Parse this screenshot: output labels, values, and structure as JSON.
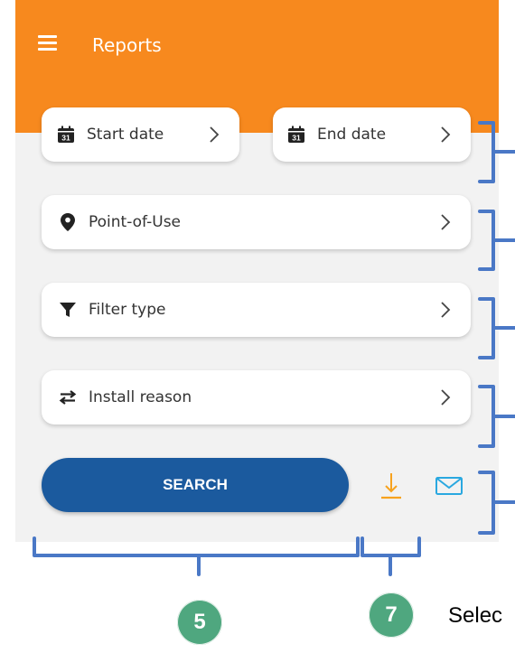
{
  "header": {
    "title": "Reports"
  },
  "filters": {
    "start_date": "Start date",
    "end_date": "End date",
    "calendar_day": "31",
    "point_of_use": "Point-of-Use",
    "filter_type": "Filter type",
    "install_reason": "Install reason"
  },
  "actions": {
    "search_label": "SEARCH"
  },
  "annotations": {
    "badge_5": "5",
    "badge_7": "7",
    "trailing_text": "Selec"
  },
  "colors": {
    "topbar": "#f7891e",
    "search_button": "#1b5a9e",
    "download_icon": "#f7a21e",
    "mail_icon": "#2aa8e0",
    "annotation_bracket": "#4a78c6",
    "badge": "#4fa77f"
  }
}
